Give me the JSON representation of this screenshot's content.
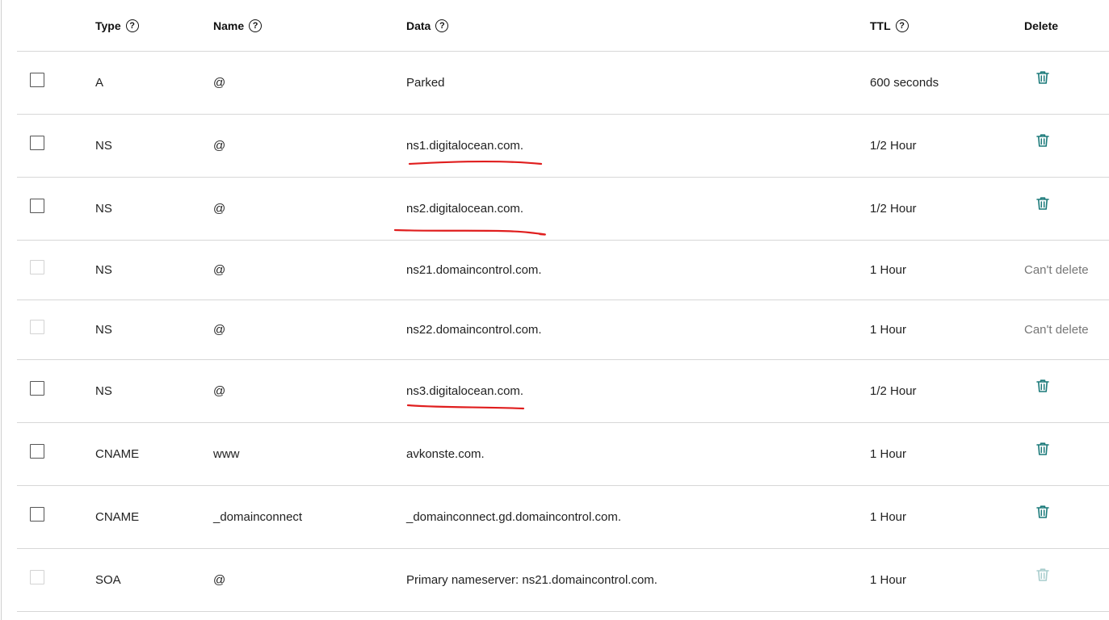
{
  "colors": {
    "accent": "#1b7a7a",
    "disabled_icon": "#a9cdcd",
    "annotation": "#e01e1e"
  },
  "columns": {
    "type": "Type",
    "name": "Name",
    "data": "Data",
    "ttl": "TTL",
    "delete": "Delete"
  },
  "records": [
    {
      "type": "A",
      "name": "@",
      "data": "Parked",
      "ttl": "600 seconds",
      "delete": "icon",
      "checkbox_enabled": true
    },
    {
      "type": "NS",
      "name": "@",
      "data": "ns1.digitalocean.com.",
      "ttl": "1/2 Hour",
      "delete": "icon",
      "checkbox_enabled": true
    },
    {
      "type": "NS",
      "name": "@",
      "data": "ns2.digitalocean.com.",
      "ttl": "1/2 Hour",
      "delete": "icon",
      "checkbox_enabled": true
    },
    {
      "type": "NS",
      "name": "@",
      "data": "ns21.domaincontrol.com.",
      "ttl": "1 Hour",
      "delete": "Can't delete",
      "checkbox_enabled": false
    },
    {
      "type": "NS",
      "name": "@",
      "data": "ns22.domaincontrol.com.",
      "ttl": "1 Hour",
      "delete": "Can't delete",
      "checkbox_enabled": false
    },
    {
      "type": "NS",
      "name": "@",
      "data": "ns3.digitalocean.com.",
      "ttl": "1/2 Hour",
      "delete": "icon",
      "checkbox_enabled": true
    },
    {
      "type": "CNAME",
      "name": "www",
      "data": "avkonste.com.",
      "ttl": "1 Hour",
      "delete": "icon",
      "checkbox_enabled": true
    },
    {
      "type": "CNAME",
      "name": "_domainconnect",
      "data": "_domainconnect.gd.domaincontrol.com.",
      "ttl": "1 Hour",
      "delete": "icon",
      "checkbox_enabled": true
    },
    {
      "type": "SOA",
      "name": "@",
      "data": "Primary nameserver: ns21.domaincontrol.com.",
      "ttl": "1 Hour",
      "delete": "icon-disabled",
      "checkbox_enabled": false
    }
  ]
}
